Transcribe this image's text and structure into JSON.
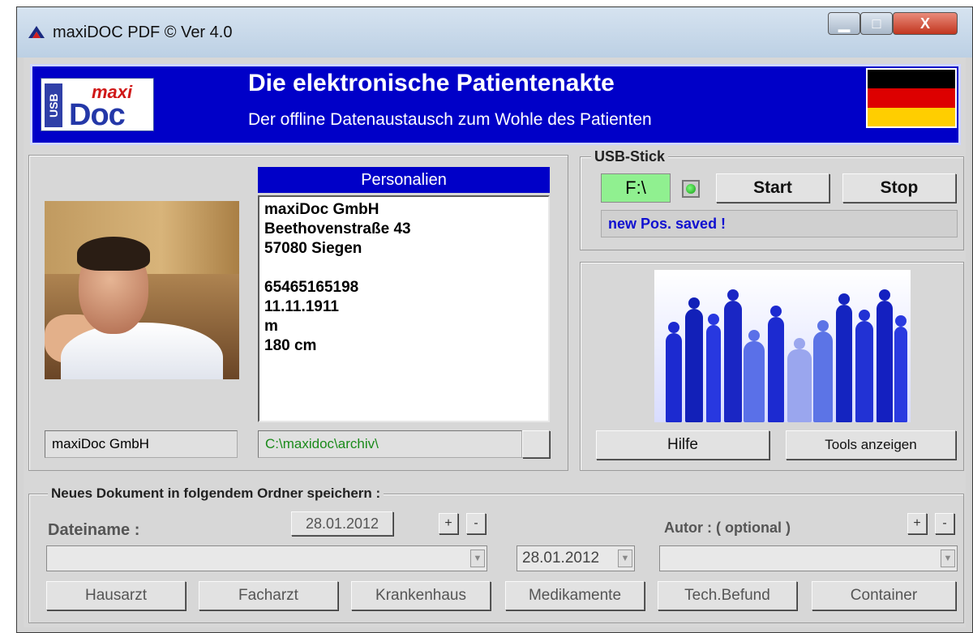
{
  "window": {
    "title": "maxiDOC PDF  ©  Ver 4.0",
    "controls": {
      "minimize": "minimize-icon",
      "maximize": "maximize-icon",
      "close": "X"
    }
  },
  "header": {
    "logo_text_usb": "USB",
    "logo_text_maxi": "maxi",
    "logo_text_doc": "Doc",
    "title": "Die elektronische Patientenakte",
    "subtitle": "Der offline Datenaustausch zum Wohle des Patienten",
    "flag_colors": [
      "#000000",
      "#dd0000",
      "#ffce00"
    ]
  },
  "personalien": {
    "header": "Personalien",
    "lines": [
      "maxiDoc GmbH",
      "Beethovenstraße 43",
      "57080 Siegen",
      "",
      "65465165198",
      "11.11.1911",
      "m",
      "180 cm"
    ],
    "name_field": "maxiDoc GmbH",
    "path_field": "C:\\maxidoc\\archiv\\"
  },
  "usb": {
    "legend": "USB-Stick",
    "drive": "F:\\",
    "start_label": "Start",
    "stop_label": "Stop",
    "status": "new Pos. saved !",
    "status_color": "#1010d0",
    "drive_color": "#90f090"
  },
  "tools": {
    "help_label": "Hilfe",
    "tools_label": "Tools anzeigen"
  },
  "document": {
    "legend": "Neues Dokument in folgendem Ordner speichern :",
    "filename_label": "Dateiname :",
    "date_button": "28.01.2012",
    "date_combo": "28.01.2012",
    "author_label": "Autor :  ( optional )",
    "plus": "+",
    "minus": "-",
    "categories": [
      "Hausarzt",
      "Facharzt",
      "Krankenhaus",
      "Medikamente",
      "Tech.Befund",
      "Container"
    ]
  },
  "colors": {
    "header_bg": "#0000c8",
    "window_bg": "#d7d7d7"
  }
}
